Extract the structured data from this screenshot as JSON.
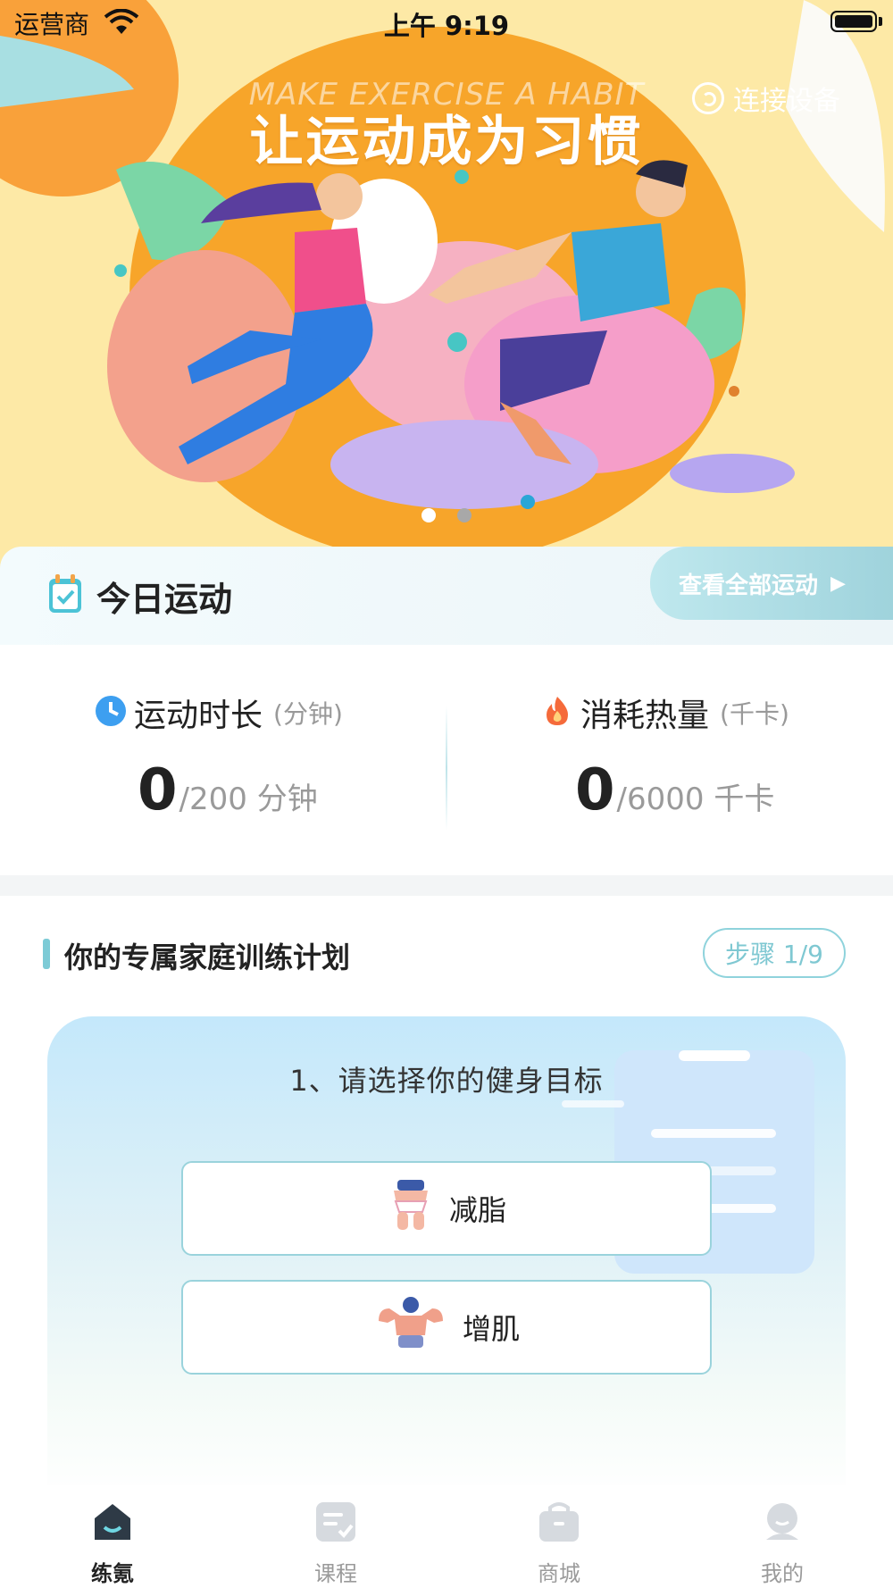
{
  "status_bar": {
    "carrier": "运营商",
    "time": "上午 9:19"
  },
  "hero": {
    "subtitle": "MAKE EXERCISE A HABIT",
    "title": "让运动成为习惯",
    "connect_label": "连接设备"
  },
  "today": {
    "title": "今日运动",
    "view_all": "查看全部运动",
    "duration": {
      "label": "运动时长",
      "unit": "(分钟)",
      "value": "0",
      "target": "/200 分钟"
    },
    "calories": {
      "label": "消耗热量",
      "unit": "(千卡)",
      "value": "0",
      "target": "/6000 千卡"
    }
  },
  "plan": {
    "title": "你的专属家庭训练计划",
    "step": "步骤 1/9",
    "question": "1、请选择你的健身目标",
    "options": [
      {
        "label": "减脂",
        "icon": "fat-loss-figure-icon"
      },
      {
        "label": "增肌",
        "icon": "muscle-gain-figure-icon"
      }
    ]
  },
  "tabbar": {
    "items": [
      {
        "label": "练氪",
        "icon": "home-icon",
        "active": true
      },
      {
        "label": "课程",
        "icon": "course-icon",
        "active": false
      },
      {
        "label": "商城",
        "icon": "shop-bag-icon",
        "active": false
      },
      {
        "label": "我的",
        "icon": "profile-icon",
        "active": false
      }
    ]
  },
  "colors": {
    "accent": "#7dcbd6",
    "hero_bg": "#fde9a6",
    "sun": "#f7a52a"
  }
}
